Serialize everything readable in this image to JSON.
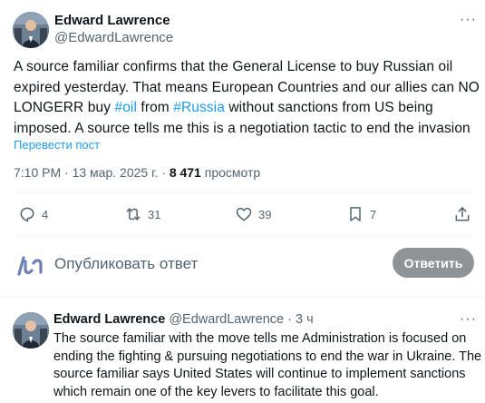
{
  "tweet": {
    "author_name": "Edward Lawrence",
    "author_handle": "@EdwardLawrence",
    "more_icon": "ellipsis-icon",
    "text_lines": [
      [
        "A source familiar confirms that the General License to buy Russian oil"
      ],
      [
        "expired yesterday. That means European Countries and our allies can NO"
      ],
      [
        "LONGERR buy ",
        "#oil",
        " from ",
        "#Russia",
        " without sanctions from US being"
      ],
      [
        "imposed. A source tells me this is a negotiation tactic to end the invasion"
      ]
    ],
    "translate_label": "Перевести пост",
    "time": "7:10 PM",
    "separator": "·",
    "date": "13 мар. 2025 г.",
    "views_count": "8 471",
    "views_label": "просмотр",
    "actions": {
      "reply_count": "4",
      "retweet_count": "31",
      "like_count": "39",
      "bookmark_count": "7"
    },
    "hashtag_color": "#1d9bf0"
  },
  "reply_composer": {
    "placeholder": "Опубликовать ответ",
    "button_label": "Ответить"
  },
  "reply": {
    "author_name": "Edward Lawrence",
    "author_handle": "@EdwardLawrence",
    "separator": "·",
    "time_ago": "3 ч",
    "text_lines": [
      "The source familiar with the move tells me Administration is focused on",
      "ending the fighting & pursuing negotiations to end the war in Ukraine. The",
      "source familiar says United States will continue to implement sanctions",
      "which remain one of the key levers to facilitate this goal."
    ]
  }
}
